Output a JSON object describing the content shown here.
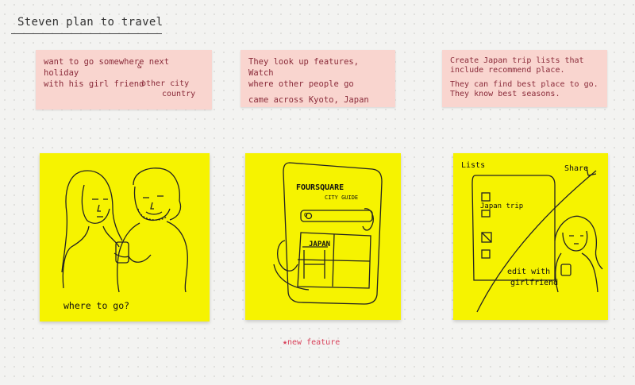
{
  "title": "Steven plan to travel",
  "notes": {
    "n1": {
      "line1": "want to go somewhere next holiday",
      "line2": "with his girl friend",
      "amp": "&",
      "sub_a": "other city",
      "sub_b": "country"
    },
    "n2": {
      "line1": "They look up features, Watch",
      "line2": "where other people go",
      "line3": "came across Kyoto, Japan"
    },
    "n3": {
      "line1": "Create Japan trip lists that",
      "line2": "include recommend place.",
      "line3": "They can find best place to go.",
      "line4": "They know best seasons."
    }
  },
  "panels": {
    "p1": {
      "caption": "where to go?"
    },
    "p2": {
      "app_line1": "FOURSQUARE",
      "app_line2": "CITY GUIDE",
      "search_letter": "Q",
      "sign": "JAPAN"
    },
    "p3": {
      "lists_label": "Lists",
      "share_label": "Share",
      "trip_label": "Japan trip",
      "edit_line1": "edit with",
      "edit_line2": "girlfriend"
    }
  },
  "footer": {
    "new_feature": "★new feature"
  }
}
